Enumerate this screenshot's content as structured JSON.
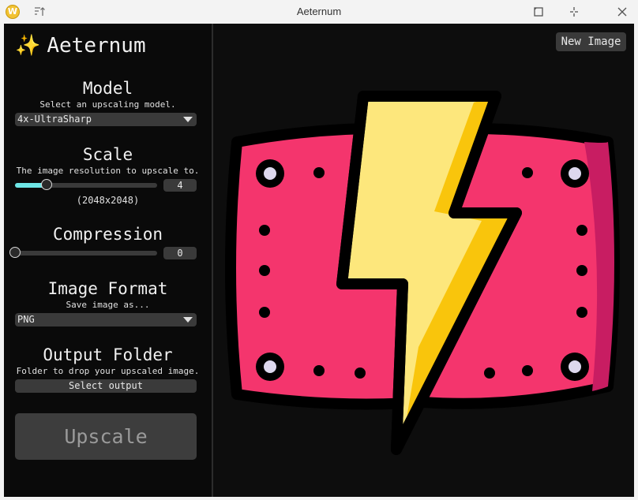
{
  "window": {
    "title": "Aeternum",
    "app_icon_letter": "W"
  },
  "sidebar": {
    "brand": {
      "emoji": "✨",
      "name": "Aeternum"
    },
    "model": {
      "title": "Model",
      "description": "Select an upscaling model.",
      "selected": "4x-UltraSharp"
    },
    "scale": {
      "title": "Scale",
      "description": "The image resolution to upscale to.",
      "value": "4",
      "fraction": 0.22,
      "resolution": "(2048x2048)"
    },
    "compression": {
      "title": "Compression",
      "value": "0",
      "fraction": 0.0
    },
    "format": {
      "title": "Image Format",
      "description": "Save image as...",
      "selected": "PNG"
    },
    "output": {
      "title": "Output Folder",
      "description": "Folder to drop your upscaled image.",
      "button_label": "Select output"
    },
    "upscale_label": "Upscale"
  },
  "preview": {
    "new_image_label": "New Image"
  },
  "colors": {
    "accent": "#6ee6e6",
    "pink": "#f4356d",
    "bolt": "#fde77c",
    "bolt_shade": "#f9c50c"
  },
  "icons": [
    "app-icon",
    "sort-menu-icon",
    "maximize-icon",
    "pin-icon",
    "close-icon",
    "chevron-down-icon"
  ]
}
